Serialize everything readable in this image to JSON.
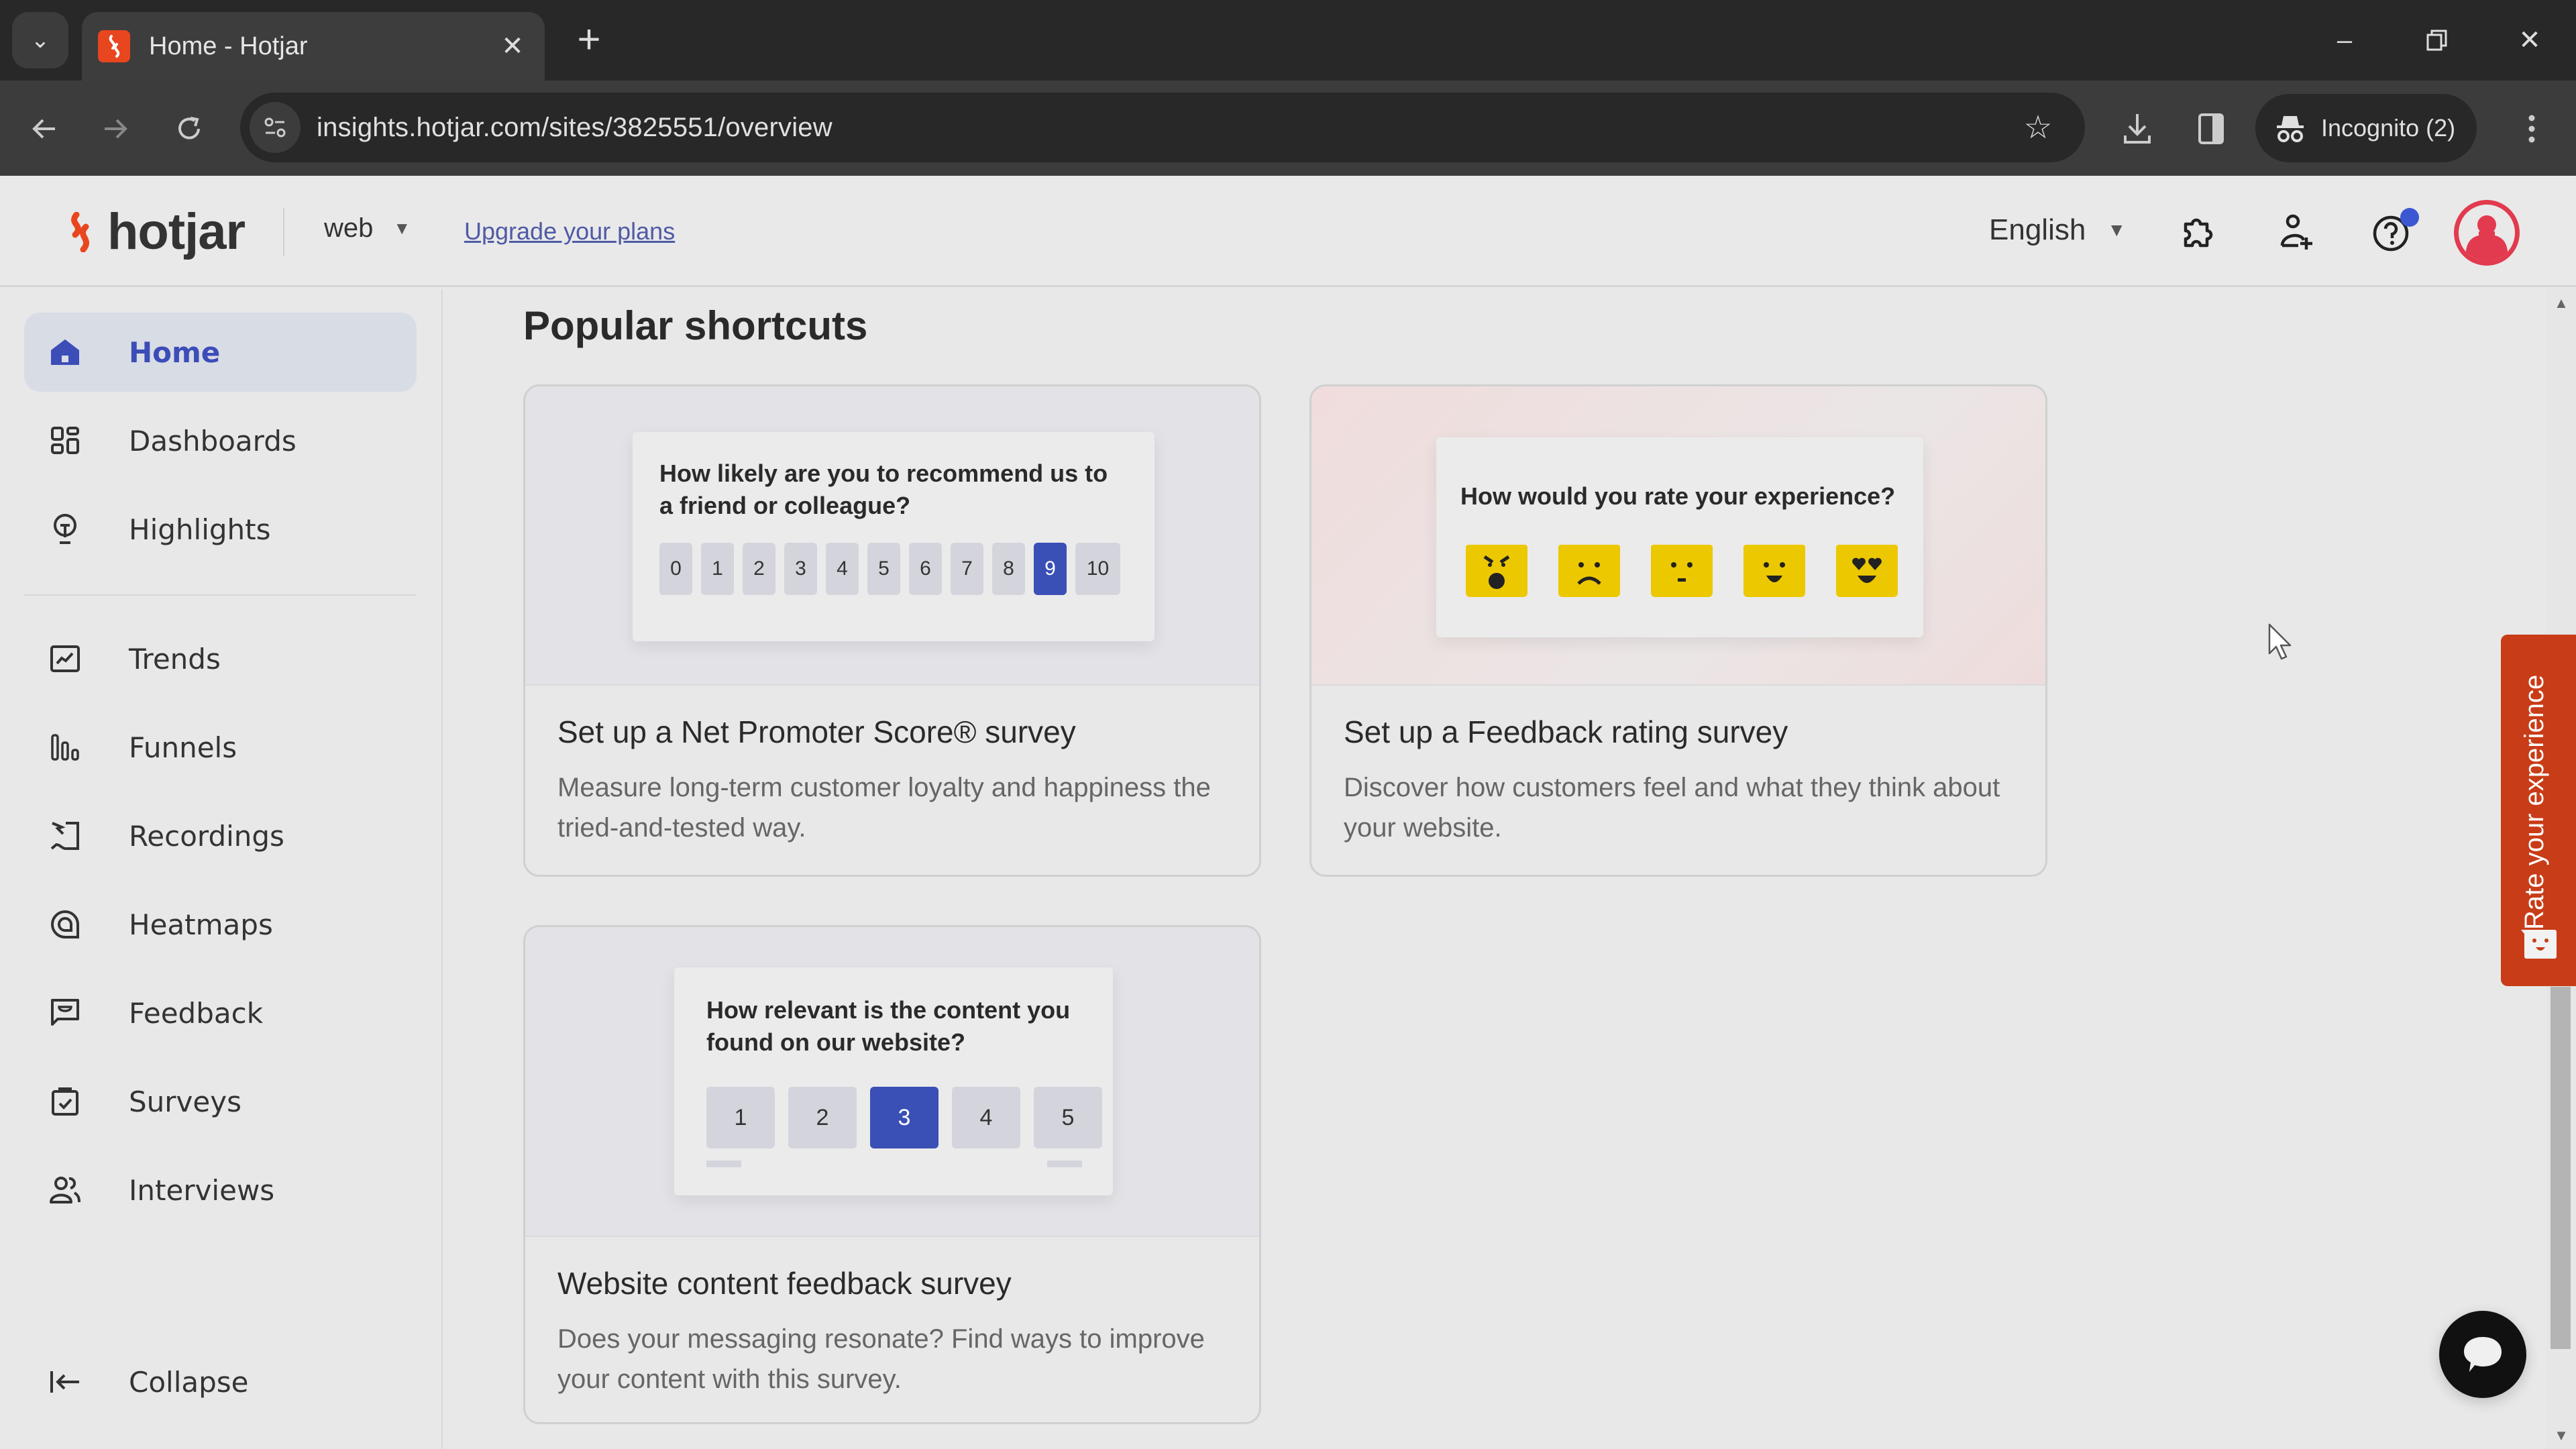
{
  "browser": {
    "tab_title": "Home - Hotjar",
    "url": "insights.hotjar.com/sites/3825551/overview",
    "incognito_label": "Incognito (2)"
  },
  "header": {
    "logo_text": "hotjar",
    "site_selector": "web",
    "upgrade_link": "Upgrade your plans",
    "language": "English"
  },
  "sidebar": {
    "items": [
      {
        "label": "Home",
        "icon": "home-icon",
        "active": true
      },
      {
        "label": "Dashboards",
        "icon": "dashboards-icon"
      },
      {
        "label": "Highlights",
        "icon": "lightbulb-icon"
      },
      {
        "label": "Trends",
        "icon": "trends-icon"
      },
      {
        "label": "Funnels",
        "icon": "funnels-icon"
      },
      {
        "label": "Recordings",
        "icon": "recordings-icon"
      },
      {
        "label": "Heatmaps",
        "icon": "heatmaps-icon"
      },
      {
        "label": "Feedback",
        "icon": "feedback-icon"
      },
      {
        "label": "Surveys",
        "icon": "surveys-icon"
      },
      {
        "label": "Interviews",
        "icon": "interviews-icon"
      }
    ],
    "collapse_label": "Collapse"
  },
  "main": {
    "section_title": "Popular shortcuts",
    "cards": [
      {
        "title": "Set up a Net Promoter Score® survey",
        "description": "Measure long-term customer loyalty and happiness the tried-and-tested way.",
        "preview_question": "How likely are you to recommend us to a friend or colleague?",
        "scale": [
          "0",
          "1",
          "2",
          "3",
          "4",
          "5",
          "6",
          "7",
          "8",
          "9",
          "10"
        ],
        "selected": "9"
      },
      {
        "title": "Set up a Feedback rating survey",
        "description": "Discover how customers feel and what they think about your website.",
        "preview_question": "How would you rate your experience?",
        "emojis": [
          "angry",
          "sad",
          "neutral",
          "happy",
          "love"
        ]
      },
      {
        "title": "Website content feedback survey",
        "description": "Does your messaging resonate? Find ways to improve your content with this survey.",
        "preview_question": "How relevant is the content you found on our website?",
        "scale": [
          "1",
          "2",
          "3",
          "4",
          "5"
        ],
        "selected": "3"
      }
    ]
  },
  "widgets": {
    "rate_tab_label": "Rate your experience"
  },
  "colors": {
    "brand_orange": "#e8461f",
    "accent_blue": "#3a50b6",
    "rate_tab": "#c83c17",
    "emoji_yellow": "#ecc800"
  }
}
